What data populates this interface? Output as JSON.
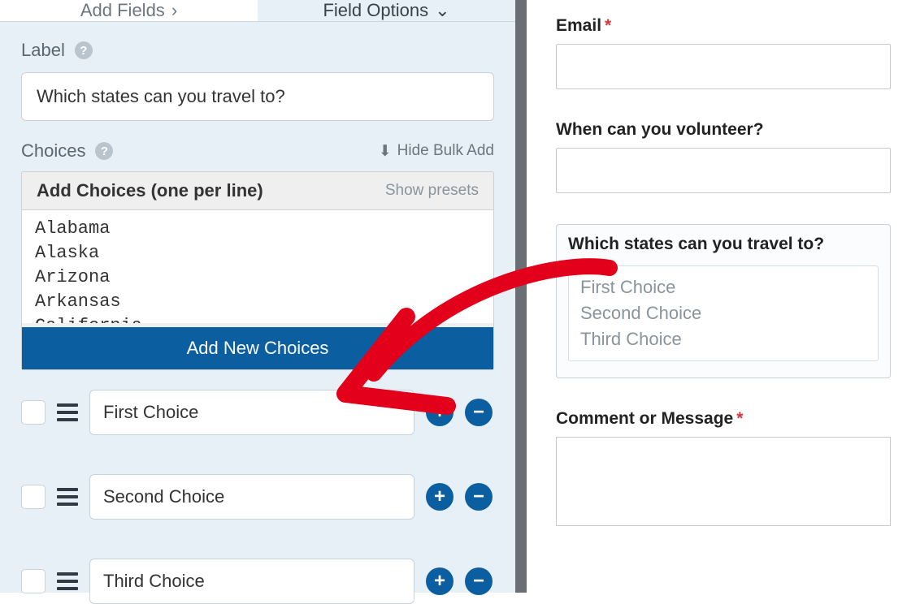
{
  "tabs": {
    "add_fields": "Add Fields",
    "field_options": "Field Options"
  },
  "label_section": {
    "title": "Label",
    "value": "Which states can you travel to?"
  },
  "choices_section": {
    "title": "Choices",
    "bulk_toggle": "Hide Bulk Add",
    "bulk_heading": "Add Choices (one per line)",
    "show_presets": "Show presets",
    "bulk_text": "Alabama\nAlaska\nArizona\nArkansas\nCalifornia",
    "add_btn": "Add New Choices",
    "items": [
      "First Choice",
      "Second Choice",
      "Third Choice"
    ]
  },
  "preview": {
    "email_label": "Email",
    "volunteer_label": "When can you volunteer?",
    "states_label": "Which states can you travel to?",
    "preview_choices": [
      "First Choice",
      "Second Choice",
      "Third Choice"
    ],
    "comment_label": "Comment or Message"
  }
}
